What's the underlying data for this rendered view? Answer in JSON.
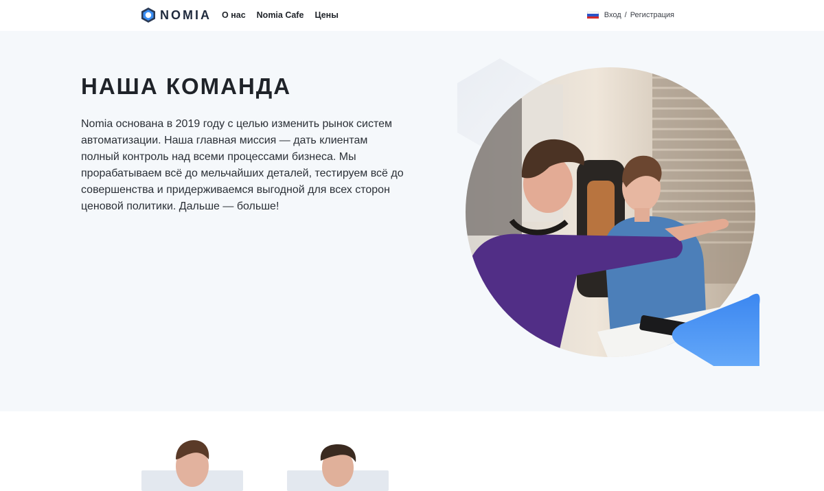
{
  "header": {
    "brand": "NOMIA",
    "nav": [
      {
        "label": "О нас"
      },
      {
        "label": "Nomia Cafe"
      },
      {
        "label": "Цены"
      }
    ],
    "auth": {
      "login": "Вход",
      "separator": "/",
      "register": "Регистрация"
    }
  },
  "hero": {
    "title": "НАША КОМАНДА",
    "text": "Nomia основана в 2019 году с целью изменить рынок систем автоматизации. Наша главная миссия — дать клиентам полный контроль над всеми процессами бизнеса. Мы прорабатываем всё до мельчайших деталей, тестируем всё до совершенства и придерживаемся выгодной для всех сторон ценовой политики. Дальше — больше!"
  },
  "colors": {
    "hero_bg": "#f5f8fb",
    "accent_blue": "#4a94f3",
    "brand_dark": "#1f2a3d",
    "member_card": "#e3e8ef"
  },
  "icons": [
    "nomia-logo-icon",
    "russian-flag-icon"
  ]
}
